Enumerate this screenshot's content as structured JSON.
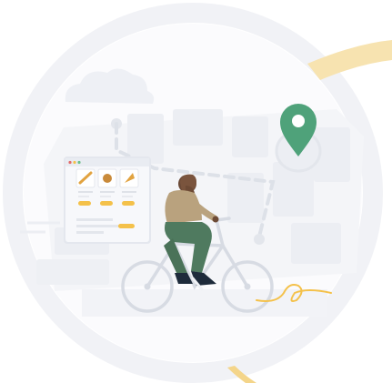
{
  "illustration": {
    "subject": "delivery-cyclist-with-map-pin",
    "icons": [
      "map-pin-icon",
      "bicycle-icon",
      "menu-card-icon",
      "cloud-icon",
      "route-icon"
    ],
    "colors": {
      "background": "#ffffff",
      "ring": "#f1f2f6",
      "map_fill": "#f5f6f9",
      "map_block": "#e9ebf1",
      "accent_yellow": "#f4c14a",
      "pin_green": "#4fa27a",
      "hoodie": "#b9a27e",
      "pants": "#4f7a5f",
      "shoes": "#1e2b3b",
      "bike": "#d7dbe3"
    }
  }
}
